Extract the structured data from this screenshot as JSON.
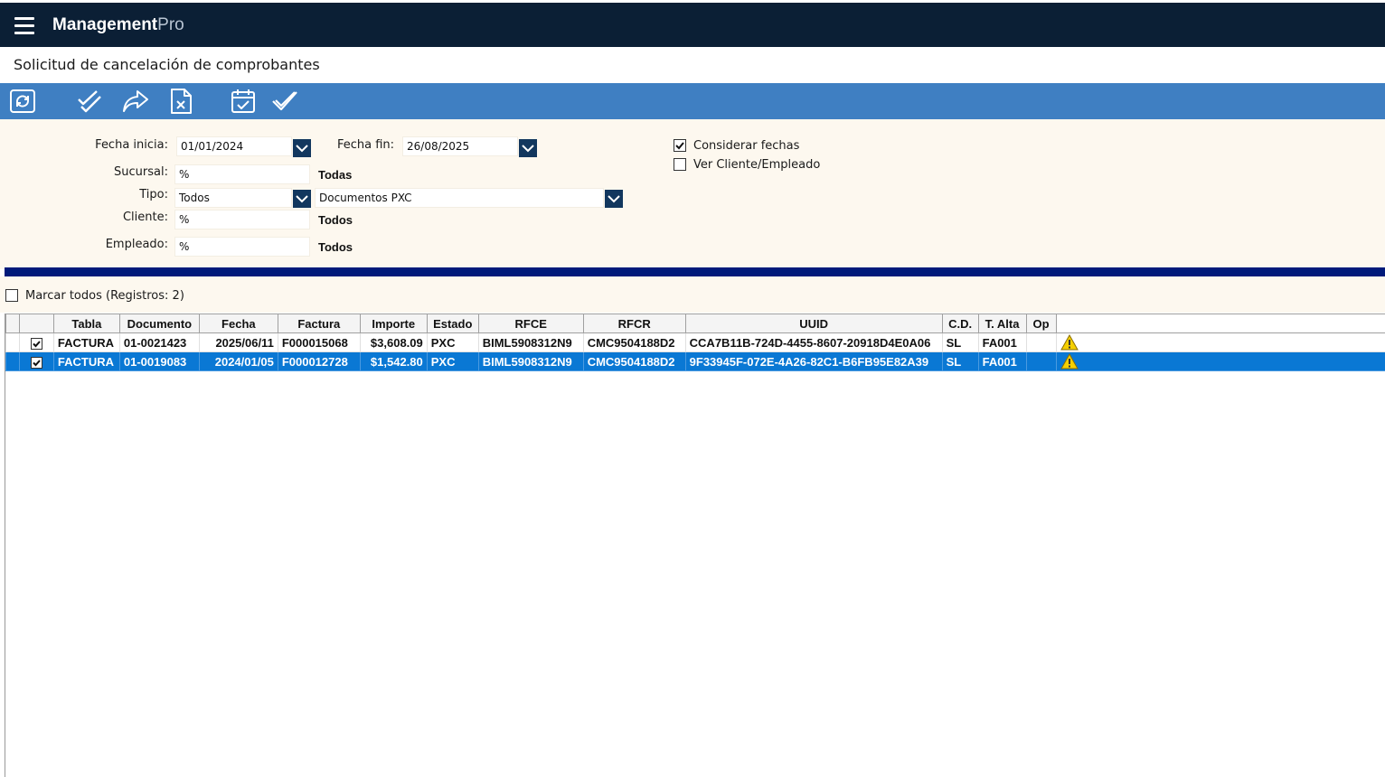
{
  "app": {
    "brand_main": "Management",
    "brand_suffix": "Pro"
  },
  "page": {
    "title": "Solicitud de cancelación de comprobantes"
  },
  "toolbar": {
    "buttons": [
      {
        "icon": "refresh-icon"
      },
      {
        "icon": "double-check-icon"
      },
      {
        "icon": "forward-arrow-icon"
      },
      {
        "icon": "cancel-document-icon"
      },
      {
        "icon": "calendar-check-icon"
      },
      {
        "icon": "check-icon"
      }
    ]
  },
  "filters": {
    "fecha_inicia_label": "Fecha inicia:",
    "fecha_inicia_value": "01/01/2024",
    "fecha_fin_label": "Fecha fin:",
    "fecha_fin_value": "26/08/2025",
    "sucursal_label": "Sucursal:",
    "sucursal_value": "%",
    "sucursal_desc": "Todas",
    "tipo_label": "Tipo:",
    "tipo_value": "Todos",
    "tipo_doc_value": "Documentos PXC",
    "cliente_label": "Cliente:",
    "cliente_value": "%",
    "cliente_desc": "Todos",
    "empleado_label": "Empleado:",
    "empleado_value": "%",
    "empleado_desc": "Todos",
    "considerar_fechas_label": "Considerar fechas",
    "considerar_fechas_checked": true,
    "ver_cliente_label": "Ver Cliente/Empleado",
    "ver_cliente_checked": false
  },
  "mark_all": {
    "label": "Marcar todos (Registros: 2)",
    "checked": false
  },
  "grid": {
    "columns": [
      "",
      "Tabla",
      "Documento",
      "Fecha",
      "Factura",
      "Importe",
      "Estado",
      "RFCE",
      "RFCR",
      "UUID",
      "C.D.",
      "T. Alta",
      "Op"
    ],
    "rows": [
      {
        "checked": true,
        "tabla": "FACTURA",
        "documento": "01-0021423",
        "fecha": "2025/06/11",
        "factura": "F000015068",
        "importe": "$3,608.09",
        "estado": "PXC",
        "rfce": "BIML5908312N9",
        "rfcr": "CMC9504188D2",
        "uuid": "CCA7B11B-724D-4455-8607-20918D4E0A06",
        "cd": "SL",
        "talta": "FA001",
        "selected": false
      },
      {
        "checked": true,
        "tabla": "FACTURA",
        "documento": "01-0019083",
        "fecha": "2024/01/05",
        "factura": "F000012728",
        "importe": "$1,542.80",
        "estado": "PXC",
        "rfce": "BIML5908312N9",
        "rfcr": "CMC9504188D2",
        "uuid": "9F33945F-072E-4A26-82C1-B6FB95E82A39",
        "cd": "SL",
        "talta": "FA001",
        "selected": true
      }
    ]
  },
  "colors": {
    "topbar": "#0b1f35",
    "toolbar": "#3f7fc2",
    "filter_bg": "#fdf8ef",
    "separator": "#001a7a",
    "selected_row": "#0a78d4",
    "dropdown": "#12375e"
  }
}
